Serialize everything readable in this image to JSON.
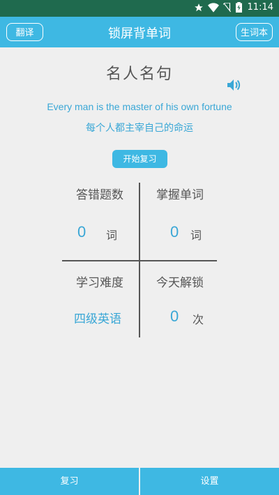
{
  "status": {
    "time": "11:14"
  },
  "appbar": {
    "title": "锁屏背单词",
    "left_button": "翻译",
    "right_button": "生词本"
  },
  "quote": {
    "heading": "名人名句",
    "english": "Every man is the master of his own  fortune",
    "chinese": "每个人都主宰自己的命运"
  },
  "review_button": "开始复习",
  "stats": {
    "wrong": {
      "label": "答错题数",
      "value": "0",
      "unit": "词"
    },
    "mastered": {
      "label": "掌握单词",
      "value": "0",
      "unit": "词"
    },
    "difficulty": {
      "label": "学习难度",
      "value": "四级英语"
    },
    "unlocks": {
      "label": "今天解锁",
      "value": "0",
      "unit": "次"
    }
  },
  "bottom_tabs": [
    "复习",
    "设置"
  ],
  "colors": {
    "accent": "#3eb8e3",
    "statusbar": "#1f6a4e",
    "text_blue": "#3aa7d6"
  }
}
